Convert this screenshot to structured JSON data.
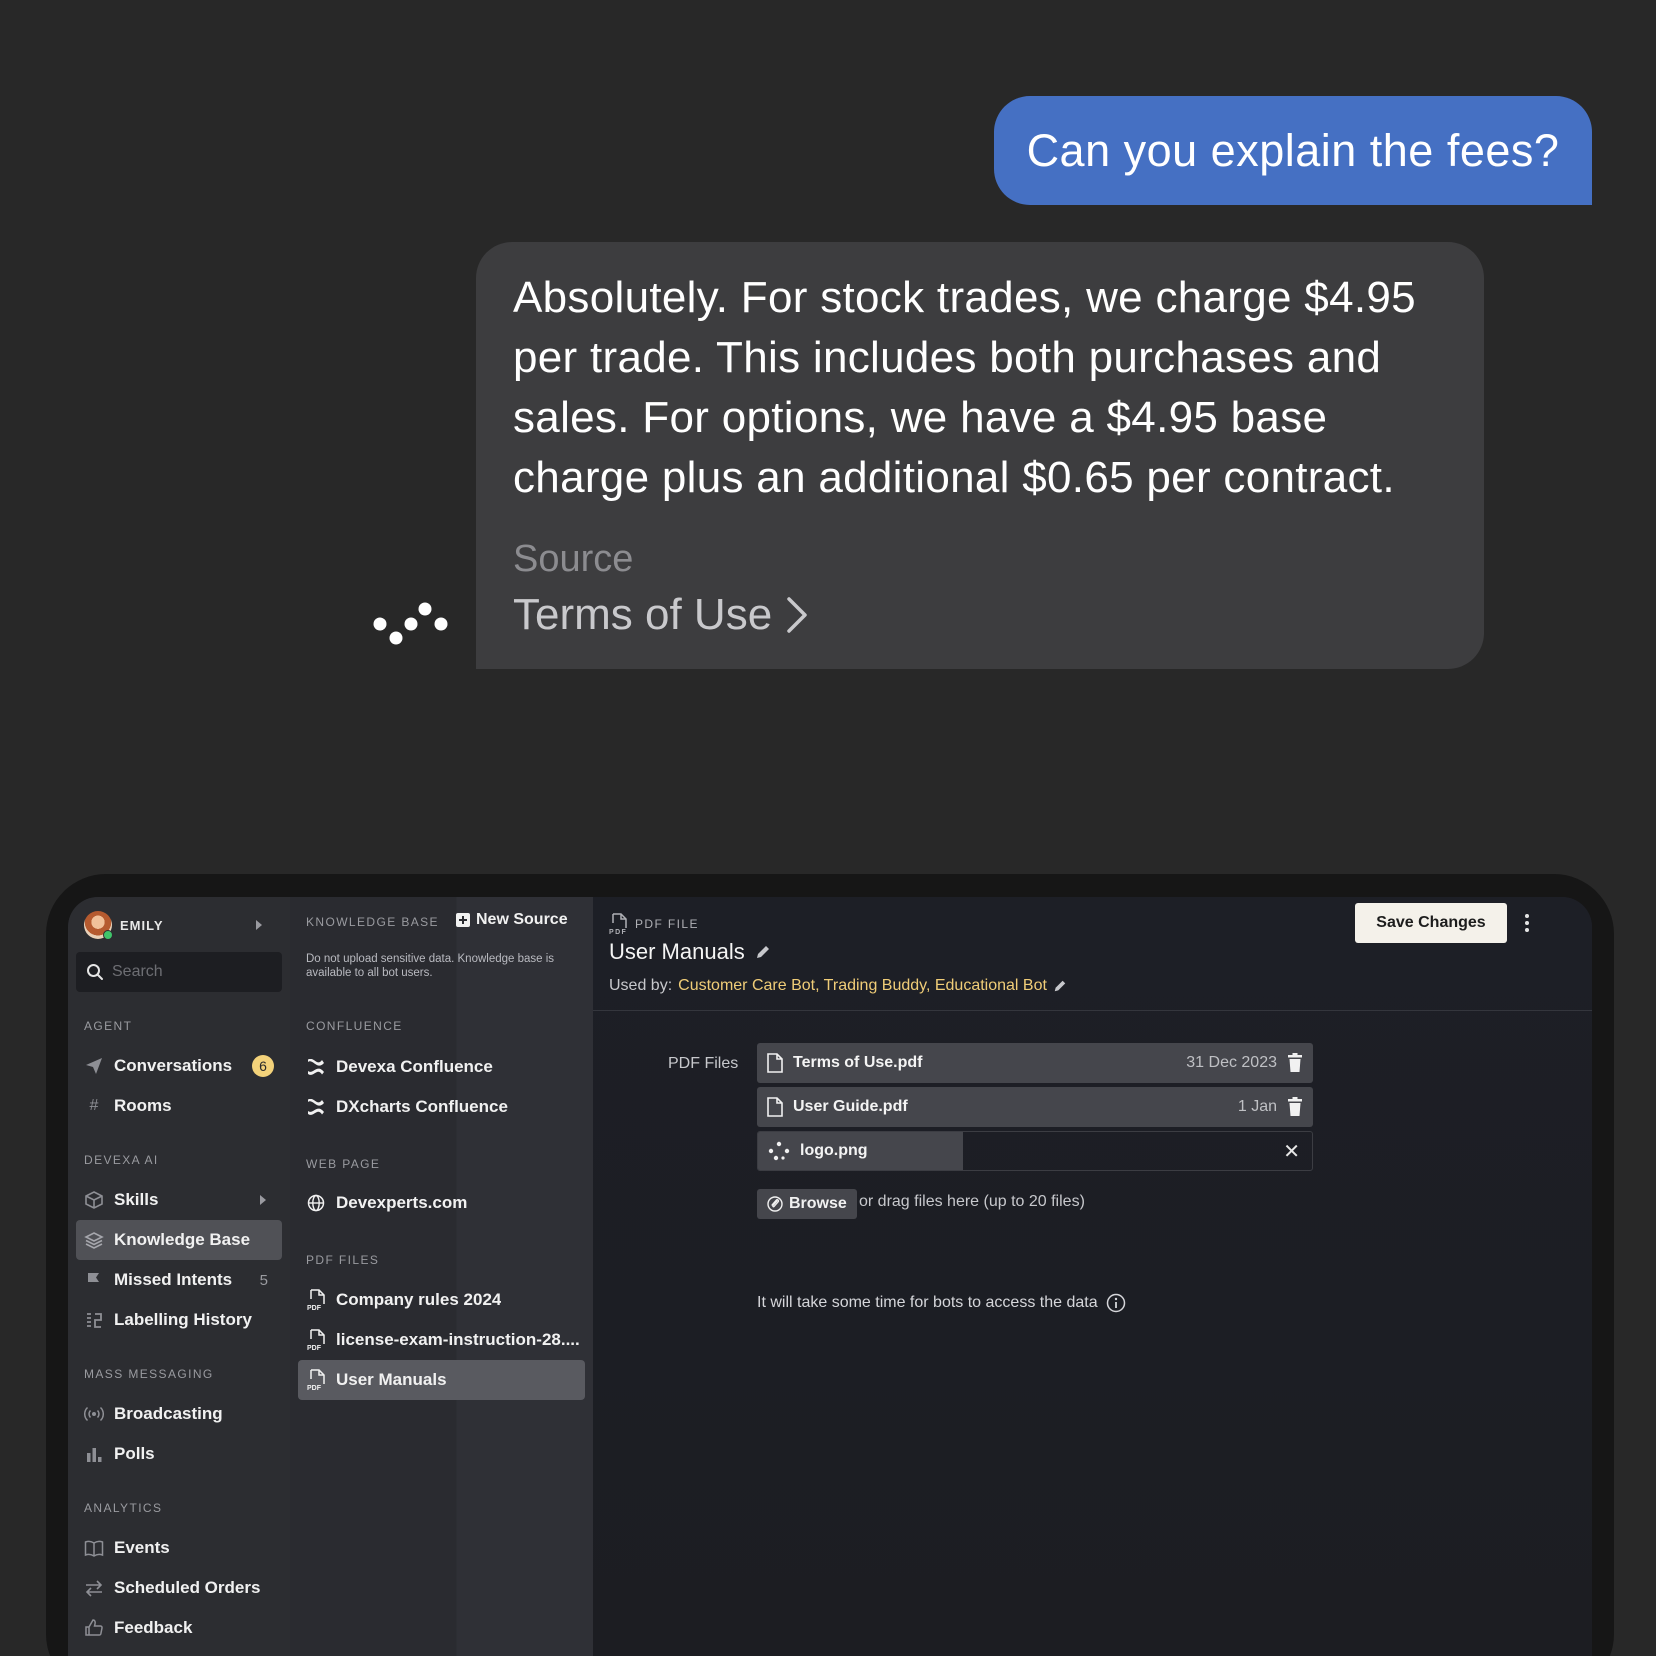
{
  "chat": {
    "user_message": "Can you explain the fees?",
    "bot_message": "Absolutely. For stock trades, we charge $4.95 per trade. This includes both purchases and sales. For options, we have a $4.95 base charge plus an additional $0.65 per contract.",
    "source_label": "Source",
    "source_link": "Terms of Use"
  },
  "sidebar": {
    "user_name": "EMILY",
    "search_placeholder": "Search",
    "sections": {
      "agent": "AGENT",
      "devexa_ai": "DEVEXA AI",
      "mass_messaging": "MASS MESSAGING",
      "analytics": "ANALYTICS"
    },
    "items": {
      "conversations": {
        "label": "Conversations",
        "badge": "6"
      },
      "rooms": {
        "label": "Rooms"
      },
      "skills": {
        "label": "Skills"
      },
      "knowledge_base": {
        "label": "Knowledge Base"
      },
      "missed_intents": {
        "label": "Missed Intents",
        "count": "5"
      },
      "labelling_history": {
        "label": "Labelling History"
      },
      "broadcasting": {
        "label": "Broadcasting"
      },
      "polls": {
        "label": "Polls"
      },
      "events": {
        "label": "Events"
      },
      "scheduled_orders": {
        "label": "Scheduled Orders"
      },
      "feedback": {
        "label": "Feedback"
      }
    }
  },
  "knowledge_base": {
    "header": "KNOWLEDGE BASE",
    "new_source_label": "New Source",
    "note": "Do not upload sensitive data. Knowledge base is available to all bot users.",
    "sections": {
      "confluence": "CONFLUENCE",
      "web_page": "WEB PAGE",
      "pdf_files": "PDF FILES"
    },
    "confluence_items": [
      "Devexa Confluence",
      "DXcharts Confluence"
    ],
    "web_items": [
      "Devexperts.com"
    ],
    "pdf_items": [
      "Company rules 2024",
      "license-exam-instruction-28....",
      "User Manuals"
    ]
  },
  "main": {
    "type_label": "PDF FILE",
    "title": "User Manuals",
    "used_by_label": "Used by:",
    "used_by_bots": "Customer Care Bot, Trading Buddy, Educational Bot",
    "save_label": "Save Changes",
    "pdf_files_label": "PDF Files",
    "files": [
      {
        "name": "Terms of Use.pdf",
        "date": "31 Dec 2023"
      },
      {
        "name": "User Guide.pdf",
        "date": "1 Jan"
      }
    ],
    "uploading_file": {
      "name": "logo.png",
      "progress": 0.37
    },
    "browse_label": "Browse",
    "browse_hint": "or drag files here (up to 20 files)",
    "info_note": "It will take some time for bots to access the data"
  },
  "colors": {
    "background": "#282828",
    "user_bubble": "#4570c3",
    "bot_bubble": "#3d3d3f",
    "accent_yellow": "#f0cd78",
    "badge": "#f3d27a"
  }
}
